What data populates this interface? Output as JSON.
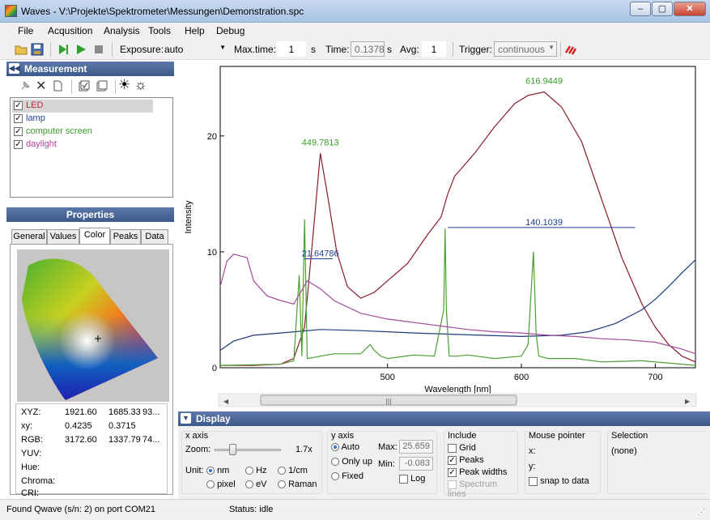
{
  "window": {
    "title": "Waves - V:\\Projekte\\Spektrometer\\Messungen\\Demonstration.spc",
    "min": "–",
    "max": "▢",
    "close": "✕"
  },
  "menu": [
    "File",
    "Acqusition",
    "Analysis",
    "Tools",
    "Help",
    "Debug"
  ],
  "toolbar": {
    "exposure_label": "Exposure:",
    "exposure_value": "auto",
    "maxtime_label": "Max.time:",
    "maxtime_value": "1",
    "maxtime_unit": "s",
    "time_label": "Time:",
    "time_value": "0.1378",
    "time_unit": "s",
    "avg_label": "Avg:",
    "avg_value": "1",
    "trigger_label": "Trigger:",
    "trigger_value": "continuous"
  },
  "measurement": {
    "title": "Measurement",
    "items": [
      {
        "label": "LED",
        "checked": true,
        "color": "#b22222",
        "selected": true
      },
      {
        "label": "lamp",
        "checked": true,
        "color": "#1f3f8f"
      },
      {
        "label": "computer screen",
        "checked": true,
        "color": "#3a9a2a"
      },
      {
        "label": "daylight",
        "checked": true,
        "color": "#b040a0"
      }
    ]
  },
  "properties": {
    "title": "Properties",
    "tabs": [
      "General",
      "Values",
      "Color",
      "Peaks",
      "Data"
    ],
    "active_tab": "Color",
    "rows": [
      {
        "label": "XYZ:",
        "v1": "1921.60",
        "v2": "1685.33",
        "v3": "93..."
      },
      {
        "label": "xy:",
        "v1": "0.4235",
        "v2": "0.3715",
        "v3": ""
      },
      {
        "label": "RGB:",
        "v1": "3172.60",
        "v2": "1337.79",
        "v3": "74..."
      },
      {
        "label": "YUV:",
        "v1": "",
        "v2": "",
        "v3": ""
      },
      {
        "label": "Hue:",
        "v1": "",
        "v2": "",
        "v3": ""
      },
      {
        "label": "Chroma:",
        "v1": "",
        "v2": "",
        "v3": ""
      },
      {
        "label": "CRI:",
        "v1": "",
        "v2": "",
        "v3": ""
      }
    ]
  },
  "chart_data": {
    "type": "line",
    "xlabel": "Wavelength [nm]",
    "ylabel": "Intensity",
    "xlim": [
      375,
      730
    ],
    "ylim": [
      0,
      26
    ],
    "xticks": [
      500,
      600,
      700
    ],
    "yticks": [
      0,
      10,
      20
    ],
    "series": [
      {
        "name": "LED",
        "color": "#8b1a2b",
        "x": [
          375,
          400,
          420,
          430,
          438,
          444,
          449.8,
          455,
          462,
          470,
          480,
          490,
          500,
          515,
          530,
          540,
          545,
          550,
          565,
          580,
          595,
          605,
          617,
          630,
          645,
          660,
          675,
          690,
          700,
          710,
          720,
          730
        ],
        "y": [
          0.2,
          0.2,
          0.3,
          0.8,
          3.5,
          11,
          18.5,
          15,
          10,
          7,
          6,
          6.5,
          7.5,
          9,
          11.5,
          13,
          15,
          16.5,
          18.5,
          20.8,
          22.8,
          23.5,
          23.8,
          22.5,
          19.5,
          14.5,
          9.5,
          5.5,
          3.5,
          2,
          1,
          0.5
        ]
      },
      {
        "name": "lamp",
        "color": "#1f3a7a",
        "x": [
          375,
          385,
          400,
          420,
          450,
          480,
          500,
          520,
          545,
          570,
          600,
          630,
          650,
          670,
          690,
          700,
          710,
          720,
          730
        ],
        "y": [
          1.5,
          2.3,
          2.8,
          3,
          3.3,
          3.2,
          3.1,
          3,
          2.9,
          2.8,
          2.7,
          2.8,
          3.1,
          3.8,
          5,
          5.9,
          7,
          8.2,
          9.3
        ]
      },
      {
        "name": "computer screen",
        "color": "#4aa032",
        "x": [
          375,
          420,
          430,
          434,
          436,
          438,
          440,
          460,
          480,
          487,
          490,
          495,
          500,
          520,
          535,
          542,
          543,
          544,
          546,
          552,
          560,
          580,
          600,
          605,
          609,
          611,
          613,
          620,
          640,
          660,
          690,
          730
        ],
        "y": [
          0.2,
          0.3,
          0.6,
          8,
          1,
          12.8,
          0.8,
          1.2,
          1.2,
          2,
          1.5,
          1,
          0.8,
          1.1,
          1,
          5,
          12,
          5,
          1,
          1,
          1.1,
          0.8,
          1,
          2,
          10,
          3,
          1,
          0.8,
          0.8,
          0.5,
          0.6,
          0.2
        ]
      },
      {
        "name": "daylight",
        "color": "#a44a9a",
        "x": [
          375,
          380,
          385,
          395,
          400,
          410,
          420,
          430,
          440,
          450,
          460,
          480,
          500,
          520,
          540,
          560,
          580,
          600,
          620,
          640,
          660,
          680,
          700,
          720,
          730
        ],
        "y": [
          7,
          9.2,
          9.8,
          9.5,
          7.5,
          6.2,
          5.8,
          5.5,
          7.5,
          6.8,
          5.8,
          4.7,
          4.2,
          3.9,
          3.6,
          3.3,
          3.1,
          3,
          2.8,
          2.7,
          2.5,
          2.4,
          2.2,
          1.6,
          1.2
        ]
      }
    ],
    "annotations": [
      {
        "text": "449.7813",
        "x": 449.7813,
        "y": 18.5
      },
      {
        "text": "616.9449",
        "x": 616.9449,
        "y": 23.8
      },
      {
        "text": "21.64786",
        "x": 449.78,
        "y": 9.4,
        "width_from": 438,
        "width_to": 459
      },
      {
        "text": "140.1039",
        "x": 616.94,
        "y": 12.1,
        "width_from": 545,
        "width_to": 685
      }
    ]
  },
  "display": {
    "title": "Display",
    "xaxis": {
      "title": "x axis",
      "zoom_label": "Zoom:",
      "zoom_value": "1.7x",
      "unit_label": "Unit:",
      "units": [
        {
          "label": "nm",
          "on": true
        },
        {
          "label": "Hz",
          "on": false
        },
        {
          "label": "1/cm",
          "on": false
        },
        {
          "label": "pixel",
          "on": false
        },
        {
          "label": "eV",
          "on": false
        },
        {
          "label": "Raman",
          "on": false
        }
      ]
    },
    "yaxis": {
      "title": "y axis",
      "modes": [
        {
          "label": "Auto",
          "on": true
        },
        {
          "label": "Only up",
          "on": false
        },
        {
          "label": "Fixed",
          "on": false
        }
      ],
      "max_label": "Max:",
      "max_value": "25.659",
      "min_label": "Min:",
      "min_value": "-0.083",
      "log_label": "Log"
    },
    "include": {
      "title": "Include",
      "items": [
        {
          "label": "Grid",
          "checked": false,
          "disabled": false
        },
        {
          "label": "Peaks",
          "checked": true,
          "disabled": false
        },
        {
          "label": "Peak widths",
          "checked": true,
          "disabled": false
        },
        {
          "label": "Spectrum lines",
          "checked": false,
          "disabled": true
        }
      ]
    },
    "mouse": {
      "title": "Mouse pointer",
      "x_label": "x:",
      "y_label": "y:",
      "snap_label": "snap to data"
    },
    "selection": {
      "title": "Selection",
      "value": "(none)"
    }
  },
  "status": {
    "left": "Found Qwave (s/n: 2) on port COM21",
    "right": "Status: idle"
  }
}
